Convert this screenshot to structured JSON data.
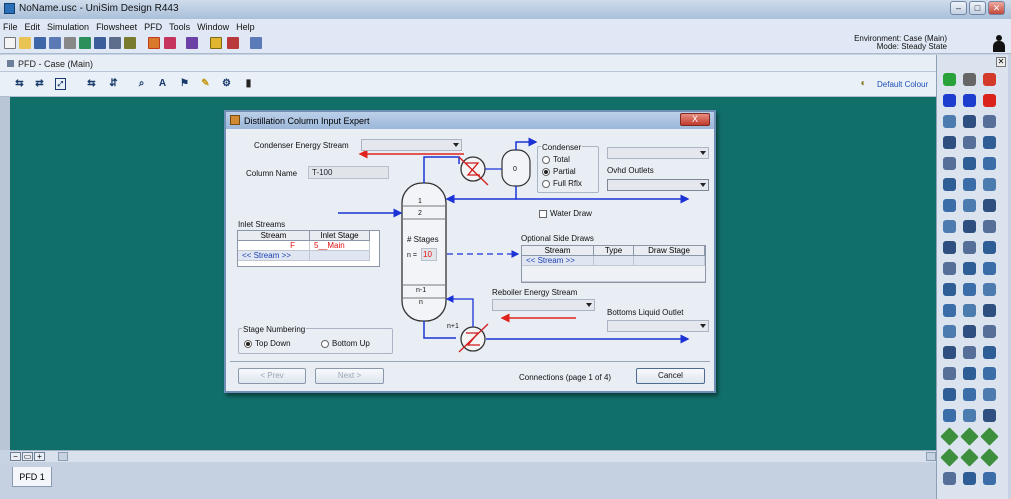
{
  "window": {
    "title": "NoName.usc - UniSim Design R443"
  },
  "menu": [
    "File",
    "Edit",
    "Simulation",
    "Flowsheet",
    "PFD",
    "Tools",
    "Window",
    "Help"
  ],
  "environment": {
    "line1": "Environment: Case (Main)",
    "line2": "Mode: Steady State"
  },
  "pfd_window": {
    "title": "PFD - Case (Main)",
    "colour_scheme": "Default Colour"
  },
  "dialog": {
    "title": "Distillation Column Input Expert",
    "close_label": "X",
    "condenser_energy_stream_label": "Condenser Energy Stream",
    "column_name_label": "Column Name",
    "column_name_value": "T-100",
    "inlet_streams_label": "Inlet Streams",
    "inlet_columns": [
      "Stream",
      "Inlet Stage"
    ],
    "inlet_rows": [
      {
        "stream": "F",
        "stage": "5__Main"
      },
      {
        "stream": "<< Stream >>",
        "stage": ""
      }
    ],
    "stage_numbering_label": "Stage Numbering",
    "stage_numbering_options": [
      "Top Down",
      "Bottom Up"
    ],
    "condenser_label": "Condenser",
    "condenser_options": [
      "Total",
      "Partial",
      "Full Rflx"
    ],
    "ovhd_outlets_label": "Ovhd Outlets",
    "water_draw_label": "Water Draw",
    "optional_side_draws_label": "Optional Side Draws",
    "side_draw_columns": [
      "Stream",
      "Type",
      "Draw Stage"
    ],
    "side_draw_row": "<< Stream >>",
    "reboiler_energy_stream_label": "Reboiler Energy Stream",
    "bottoms_liquid_outlet_label": "Bottoms Liquid Outlet",
    "column_labels": {
      "stage1": "1",
      "stage2": "2",
      "stages": "# Stages",
      "n_eq": "n =",
      "n_value": "10",
      "n_minus_1": "n-1",
      "n": "n",
      "n_plus_1": "n+1",
      "condenser_stage": "0"
    },
    "prev_label": "< Prev",
    "next_label": "Next >",
    "connections_label": "Connections (page 1 of 4)",
    "cancel_label": "Cancel"
  },
  "bottom_tab": "PFD 1",
  "colors": {
    "canvas": "#116f6a",
    "stream_blue": "#1b33d6",
    "energy_red": "#e2221c",
    "dialog_bg": "#e9eef5"
  }
}
